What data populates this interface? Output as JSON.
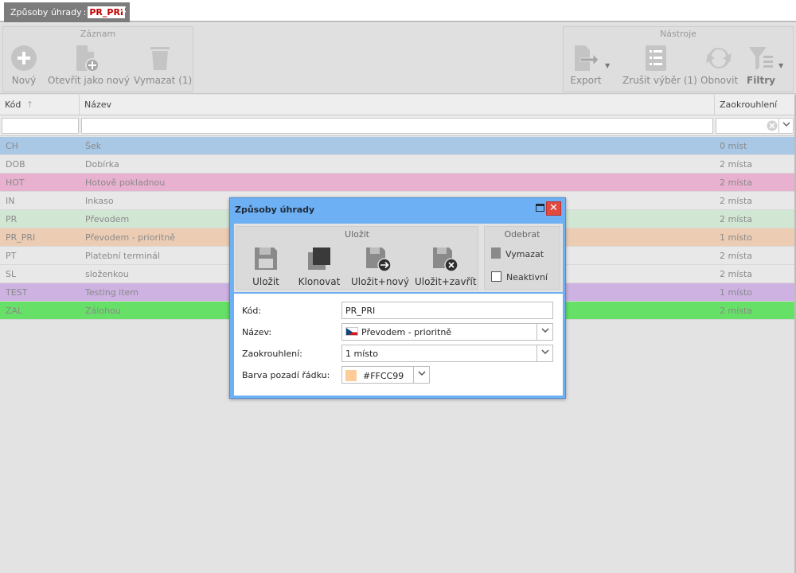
{
  "tab": {
    "title": "Způsoby úhrady",
    "separator": ":",
    "code": "PR_PRI",
    "close": "×"
  },
  "toolbar": {
    "record_group": "Záznam",
    "tools_group": "Nástroje",
    "new": "Nový",
    "open_as_new": "Otevřít jako nový",
    "delete": "Vymazat (1)",
    "export": "Export",
    "cancel_selection": "Zrušit výběr (1)",
    "refresh": "Obnovit",
    "filters": "Filtry"
  },
  "grid": {
    "columns": {
      "code": "Kód",
      "name": "Název",
      "rounding": "Zaokrouhlení"
    },
    "sort_indicator": "↑",
    "rows": [
      {
        "code": "CH",
        "name": "Šek",
        "rounding": "0 míst",
        "color": "#a8c8e6"
      },
      {
        "code": "DOB",
        "name": "Dobírka",
        "rounding": "2 místa",
        "color": "#e8e8e8"
      },
      {
        "code": "HOT",
        "name": "Hotově pokladnou",
        "rounding": "2 místa",
        "color": "#e8b1cf"
      },
      {
        "code": "IN",
        "name": "Inkaso",
        "rounding": "2 místa",
        "color": "#e8e8e8"
      },
      {
        "code": "PR",
        "name": "Převodem",
        "rounding": "2 místa",
        "color": "#d2e6d4"
      },
      {
        "code": "PR_PRI",
        "name": "Převodem - prioritně",
        "rounding": "1 místo",
        "color": "#eccdb4"
      },
      {
        "code": "PT",
        "name": "Platební terminál",
        "rounding": "2 místa",
        "color": "#e8e8e8"
      },
      {
        "code": "SL",
        "name": "složenkou",
        "rounding": "2 místa",
        "color": "#e8e8e8"
      },
      {
        "code": "TEST",
        "name": "Testing item",
        "rounding": "1 místo",
        "color": "#cdb2e2"
      },
      {
        "code": "ZAL",
        "name": "Zálohou",
        "rounding": "2 místa",
        "color": "#66e066"
      }
    ]
  },
  "modal": {
    "title": "Způsoby úhrady",
    "close": "✕",
    "save_group": "Uložit",
    "remove_group": "Odebrat",
    "save": "Uložit",
    "clone": "Klonovat",
    "save_new": "Uložit+nový",
    "save_close": "Uložit+zavřít",
    "delete": "Vymazat",
    "inactive": "Neaktivní",
    "form": {
      "code_label": "Kód:",
      "code_value": "PR_PRI",
      "name_label": "Název:",
      "name_value": "Převodem - prioritně",
      "rounding_label": "Zaokrouhlení:",
      "rounding_value": "1 místo",
      "color_label": "Barva pozadí řádku:",
      "color_value": "#FFCC99"
    }
  }
}
